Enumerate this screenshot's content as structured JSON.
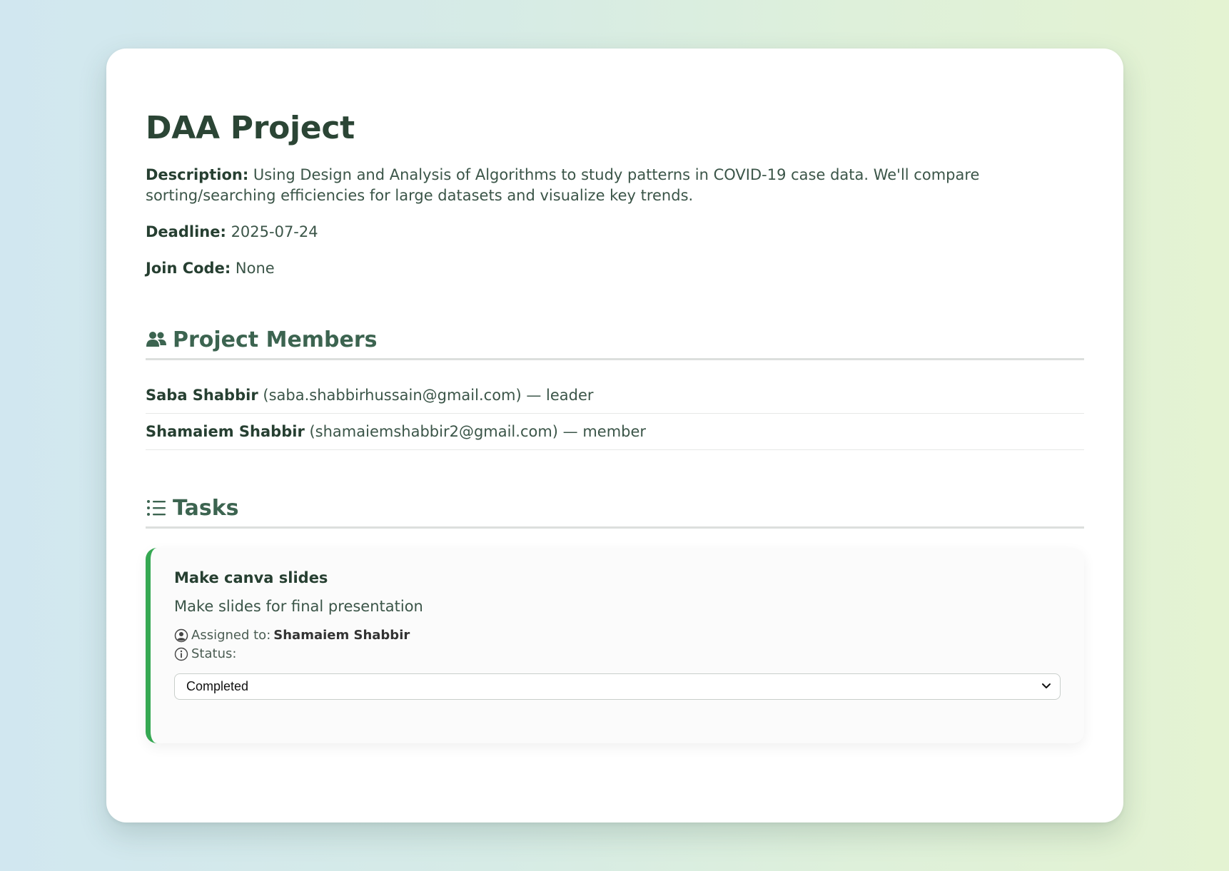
{
  "project": {
    "title": "DAA Project",
    "description_label": "Description:",
    "description": "Using Design and Analysis of Algorithms to study patterns in COVID-19 case data. We'll compare sorting/searching efficiencies for large datasets and visualize key trends.",
    "deadline_label": "Deadline:",
    "deadline": "2025-07-24",
    "join_code_label": "Join Code:",
    "join_code": "None"
  },
  "members_section": {
    "heading": "Project Members",
    "icon": "users-icon",
    "members": [
      {
        "name": "Saba Shabbir",
        "email": "(saba.shabbirhussain@gmail.com)",
        "role": "— leader"
      },
      {
        "name": "Shamaiem Shabbir",
        "email": "(shamaiemshabbir2@gmail.com)",
        "role": "— member"
      }
    ]
  },
  "tasks_section": {
    "heading": "Tasks",
    "icon": "list-icon",
    "tasks": [
      {
        "title": "Make canva slides",
        "description": "Make slides for final presentation",
        "assigned_label": "Assigned to:",
        "assignee": "Shamaiem Shabbir",
        "status_label": "Status:",
        "status_value": "Completed"
      }
    ]
  },
  "colors": {
    "accent_green": "#35a852",
    "heading_green": "#3c6450",
    "text_dark": "#263f31"
  }
}
